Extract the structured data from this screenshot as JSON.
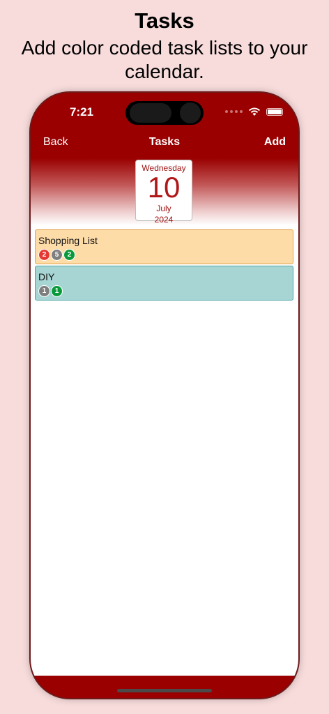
{
  "promo": {
    "title": "Tasks",
    "subtitle": "Add color coded task lists to your calendar."
  },
  "status_bar": {
    "time": "7:21",
    "icons": [
      "cellular-signal-icon",
      "wifi-icon",
      "battery-icon"
    ]
  },
  "nav": {
    "back_label": "Back",
    "title": "Tasks",
    "add_label": "Add"
  },
  "date_card": {
    "weekday": "Wednesday",
    "day": "10",
    "month": "July",
    "year": "2024"
  },
  "task_lists": [
    {
      "name": "Shopping List",
      "color": "#fddca8",
      "border": "#e3a24a",
      "badges": [
        {
          "count": "2",
          "color": "#e53935"
        },
        {
          "count": "5",
          "color": "#7e7e7e"
        },
        {
          "count": "2",
          "color": "#0a9a3c"
        }
      ]
    },
    {
      "name": "DIY",
      "color": "#a6d5d4",
      "border": "#4aa39f",
      "badges": [
        {
          "count": "1",
          "color": "#7e7e7e"
        },
        {
          "count": "1",
          "color": "#0a9a3c"
        }
      ]
    }
  ],
  "colors": {
    "accent": "#9a0000",
    "page_background": "#f8dcdc"
  }
}
